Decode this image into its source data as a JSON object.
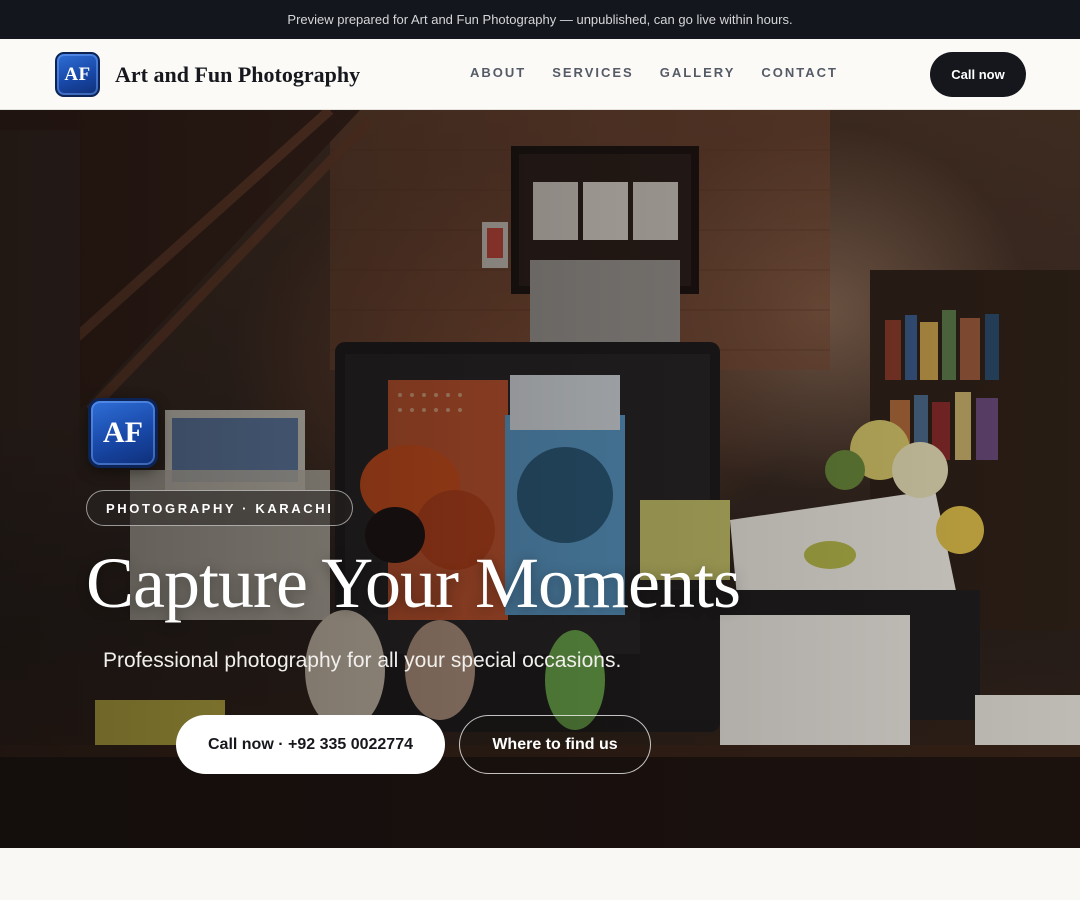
{
  "preview_banner": {
    "text": "Preview prepared for Art and Fun Photography — unpublished, can go live within hours."
  },
  "header": {
    "logo_text": "AF",
    "brand_name": "Art and Fun Photography",
    "nav": [
      {
        "label": "ABOUT"
      },
      {
        "label": "SERVICES"
      },
      {
        "label": "GALLERY"
      },
      {
        "label": "CONTACT"
      }
    ],
    "call_button": "Call now"
  },
  "hero": {
    "logo_text": "AF",
    "tag": "PHOTOGRAPHY · KARACHI",
    "title": "Capture Your Moments",
    "subtitle": "Professional photography for all your special occasions.",
    "primary_button": "Call now · +92 335 0022774",
    "secondary_button": "Where to find us"
  },
  "colors": {
    "banner_bg": "#13161c",
    "header_bg": "#fbfaf7",
    "dark_button": "#15171c",
    "logo_blue": "#1848a8"
  }
}
